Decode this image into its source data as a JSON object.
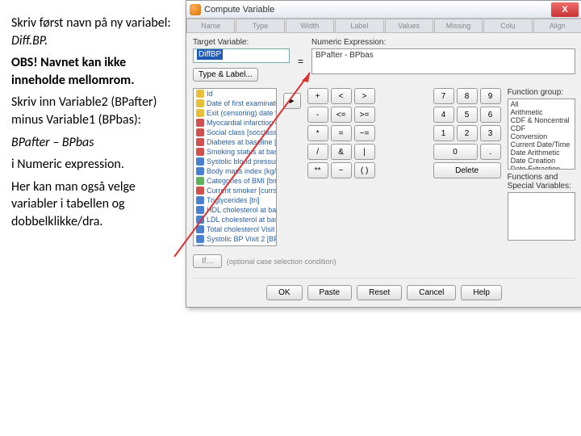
{
  "instructions": {
    "p1a": "Skriv først navn på ny variabel: ",
    "p1b": "Diff.BP.",
    "p2": "OBS! Navnet kan ikke inneholde mellomrom.",
    "p3": "Skriv inn Variable2 (BPafter) minus Variable1 (BPbas):",
    "p4": "BPafter – BPbas",
    "p5": "i Numeric expression.",
    "p6": "Her kan man også velge variabler i tabellen og dobbelklikke/dra."
  },
  "dialog": {
    "title": "Compute Variable",
    "close": "X",
    "tabs": [
      "Name",
      "Type",
      "Width",
      "Label",
      "Values",
      "Missing",
      "Colu",
      "Align"
    ],
    "target_label": "Target Variable:",
    "target_value": "DiffBP",
    "type_label_btn": "Type & Label...",
    "eq": "=",
    "expr_label": "Numeric Expression:",
    "expr_value": "BPafter - BPbas",
    "xfer": "►",
    "variables": [
      {
        "icon": "ic-yellow",
        "label": "Id"
      },
      {
        "icon": "ic-yellow",
        "label": "Date of first examination..."
      },
      {
        "icon": "ic-yellow",
        "label": "Exit (censoring) date for ..."
      },
      {
        "icon": "ic-red",
        "label": "Myocardial infarction or d..."
      },
      {
        "icon": "ic-red",
        "label": "Social class [socclass]"
      },
      {
        "icon": "ic-red",
        "label": "Diabetes at baseline [dia..."
      },
      {
        "icon": "ic-red",
        "label": "Smoking status at baseli..."
      },
      {
        "icon": "ic-blue",
        "label": "Systolic blood pressure a..."
      },
      {
        "icon": "ic-blue",
        "label": "Body mass index (kg/m2)..."
      },
      {
        "icon": "ic-green",
        "label": "Categories of BMI [bmicat]"
      },
      {
        "icon": "ic-red",
        "label": "Current smoker [currsmok]"
      },
      {
        "icon": "ic-blue",
        "label": "Triglycerides [tri]"
      },
      {
        "icon": "ic-blue",
        "label": "HDL cholesterol at baseli..."
      },
      {
        "icon": "ic-blue",
        "label": "LDL cholesterol at baseli..."
      },
      {
        "icon": "ic-blue",
        "label": "Total cholesterol Visit 2 [t..."
      },
      {
        "icon": "ic-blue",
        "label": "Systolic BP Visit 2 [BPafter]"
      },
      {
        "icon": "ic-blue",
        "label": "DiffBP"
      }
    ],
    "keypad": [
      [
        "+",
        "<",
        ">",
        "7",
        "8",
        "9"
      ],
      [
        "-",
        "<=",
        ">=",
        "4",
        "5",
        "6"
      ],
      [
        "*",
        "=",
        "~=",
        "1",
        "2",
        "3"
      ],
      [
        "/",
        "&",
        "|",
        "0",
        "."
      ],
      [
        "**",
        "~",
        "( )",
        "Delete"
      ]
    ],
    "func_group_label": "Function group:",
    "func_groups": [
      "All",
      "Arithmetic",
      "CDF & Noncentral CDF",
      "Conversion",
      "Current Date/Time",
      "Date Arithmetic",
      "Date Creation",
      "Date Extraction"
    ],
    "func_spec_label": "Functions and Special Variables:",
    "if_btn": "If...",
    "if_text": "(optional case selection condition)",
    "buttons": [
      "OK",
      "Paste",
      "Reset",
      "Cancel",
      "Help"
    ]
  }
}
